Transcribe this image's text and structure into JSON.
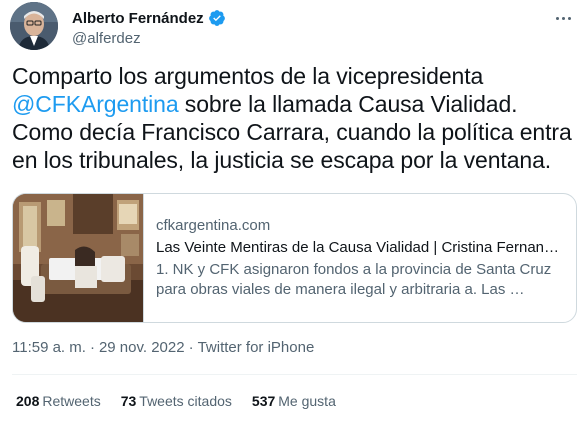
{
  "author": {
    "name": "Alberto Fernández",
    "handle": "@alferdez",
    "verified": true
  },
  "tweet": {
    "line1": "Comparto los argumentos de la vicepresidenta",
    "mention": "@CFKArgentina",
    "line2_rest": " sobre la llamada Causa Vialidad.",
    "line3": "Como decía Francisco Carrara, cuando la política entra",
    "line4": "en los tribunales, la justicia se escapa por la ventana."
  },
  "link_card": {
    "domain": "cfkargentina.com",
    "title": "Las Veinte Mentiras de la Causa Vialidad | Cristina Fernand…",
    "description": "1. NK y CFK asignaron fondos a la provincia de Santa Cruz para obras viales de manera ilegal y arbitraria a. Las …"
  },
  "meta": {
    "time": "11:59 a. m.",
    "separator": "·",
    "date": "29 nov. 2022",
    "source": "Twitter for iPhone"
  },
  "stats": {
    "retweets_count": "208",
    "retweets_label": "Retweets",
    "quotes_count": "73",
    "quotes_label": "Tweets citados",
    "likes_count": "537",
    "likes_label": "Me gusta"
  },
  "colors": {
    "accent": "#1d9bf0",
    "text": "#0f1419",
    "secondary": "#536471",
    "border": "#cfd9de"
  }
}
